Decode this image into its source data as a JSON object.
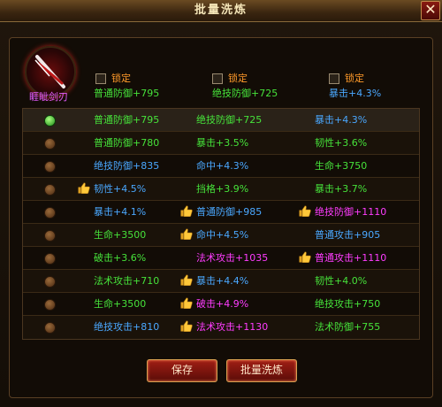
{
  "title": "批量洗炼",
  "close_glyph": "✕",
  "weapon": {
    "name": "睚眦剑刃",
    "icon": "sword-icon"
  },
  "locks": [
    "锁定",
    "锁定",
    "锁定"
  ],
  "current": [
    {
      "text": "普通防御+795",
      "color": "green"
    },
    {
      "text": "绝技防御+725",
      "color": "green"
    },
    {
      "text": "暴击+4.3%",
      "color": "blue"
    }
  ],
  "rows": [
    {
      "selected": true,
      "cells": [
        {
          "text": "普通防御+795",
          "color": "green",
          "thumb": false
        },
        {
          "text": "绝技防御+725",
          "color": "green",
          "thumb": false
        },
        {
          "text": "暴击+4.3%",
          "color": "blue",
          "thumb": false
        }
      ]
    },
    {
      "selected": false,
      "cells": [
        {
          "text": "普通防御+780",
          "color": "green",
          "thumb": false
        },
        {
          "text": "暴击+3.5%",
          "color": "green",
          "thumb": false
        },
        {
          "text": "韧性+3.6%",
          "color": "green",
          "thumb": false
        }
      ]
    },
    {
      "selected": false,
      "cells": [
        {
          "text": "绝技防御+835",
          "color": "blue",
          "thumb": false
        },
        {
          "text": "命中+4.3%",
          "color": "blue",
          "thumb": false
        },
        {
          "text": "生命+3750",
          "color": "green",
          "thumb": false
        }
      ]
    },
    {
      "selected": false,
      "cells": [
        {
          "text": "韧性+4.5%",
          "color": "blue",
          "thumb": true
        },
        {
          "text": "挡格+3.9%",
          "color": "green",
          "thumb": false
        },
        {
          "text": "暴击+3.7%",
          "color": "green",
          "thumb": false
        }
      ]
    },
    {
      "selected": false,
      "cells": [
        {
          "text": "暴击+4.1%",
          "color": "blue",
          "thumb": false
        },
        {
          "text": "普通防御+985",
          "color": "blue",
          "thumb": true
        },
        {
          "text": "绝技防御+1110",
          "color": "pink",
          "thumb": true
        }
      ]
    },
    {
      "selected": false,
      "cells": [
        {
          "text": "生命+3500",
          "color": "green",
          "thumb": false
        },
        {
          "text": "命中+4.5%",
          "color": "blue",
          "thumb": true
        },
        {
          "text": "普通攻击+905",
          "color": "blue",
          "thumb": false
        }
      ]
    },
    {
      "selected": false,
      "cells": [
        {
          "text": "破击+3.6%",
          "color": "green",
          "thumb": false
        },
        {
          "text": "法术攻击+1035",
          "color": "pink",
          "thumb": false
        },
        {
          "text": "普通攻击+1110",
          "color": "pink",
          "thumb": true
        }
      ]
    },
    {
      "selected": false,
      "cells": [
        {
          "text": "法术攻击+710",
          "color": "green",
          "thumb": false
        },
        {
          "text": "暴击+4.4%",
          "color": "blue",
          "thumb": true
        },
        {
          "text": "韧性+4.0%",
          "color": "green",
          "thumb": false
        }
      ]
    },
    {
      "selected": false,
      "cells": [
        {
          "text": "生命+3500",
          "color": "green",
          "thumb": false
        },
        {
          "text": "破击+4.9%",
          "color": "pink",
          "thumb": true
        },
        {
          "text": "绝技攻击+750",
          "color": "green",
          "thumb": false
        }
      ]
    },
    {
      "selected": false,
      "cells": [
        {
          "text": "绝技攻击+810",
          "color": "blue",
          "thumb": false
        },
        {
          "text": "法术攻击+1130",
          "color": "pink",
          "thumb": true
        },
        {
          "text": "法术防御+755",
          "color": "green",
          "thumb": false
        }
      ]
    }
  ],
  "buttons": {
    "save": "保存",
    "batch_wash": "批量洗炼"
  },
  "colors": {
    "green": "#46e23a",
    "blue": "#4aa8ff",
    "pink": "#ff3cff",
    "lock": "#ff9a2a",
    "weapon_name": "#e45cff"
  }
}
